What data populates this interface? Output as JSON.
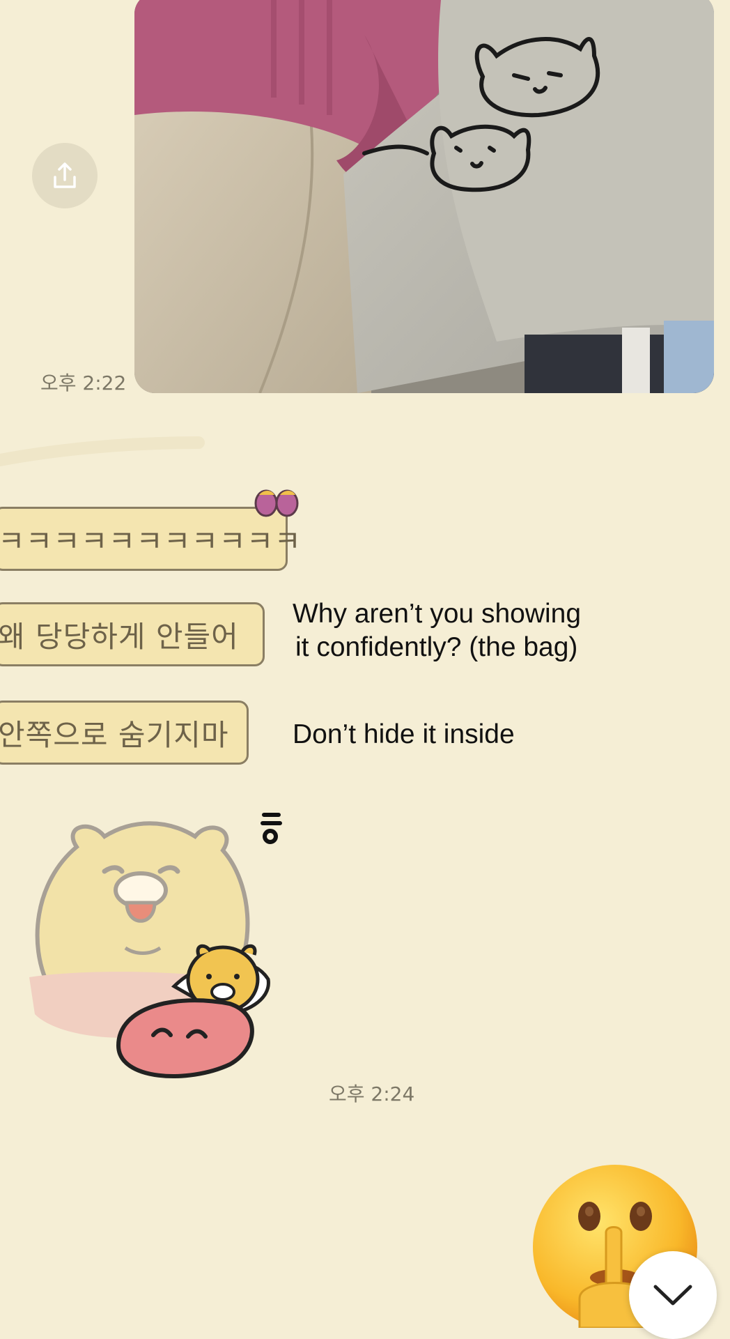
{
  "messages": {
    "photo_time": "오후 2:22",
    "bubble_1": "ㅋㅋㅋㅋㅋㅋㅋㅋㅋㅋㅋ",
    "bubble_2": "왜 당당하게 안들어",
    "bubble_3": "안쪽으로 숨기지마",
    "sticker_time": "오후 2:24"
  },
  "annotations": {
    "line_1a": "Why aren’t you showing",
    "line_1b": "it confidently? (the bag)",
    "line_2": "Don’t hide it inside"
  },
  "icons": {
    "share": "share-icon",
    "scroll_down": "chevron-down-icon",
    "emoji": "shushing-face-emoji",
    "sticker": "sleeping-bear-sticker"
  },
  "colors": {
    "background": "#f5eed5",
    "bubble": "#f4e5b0",
    "bubble_border": "#8a7e63"
  }
}
